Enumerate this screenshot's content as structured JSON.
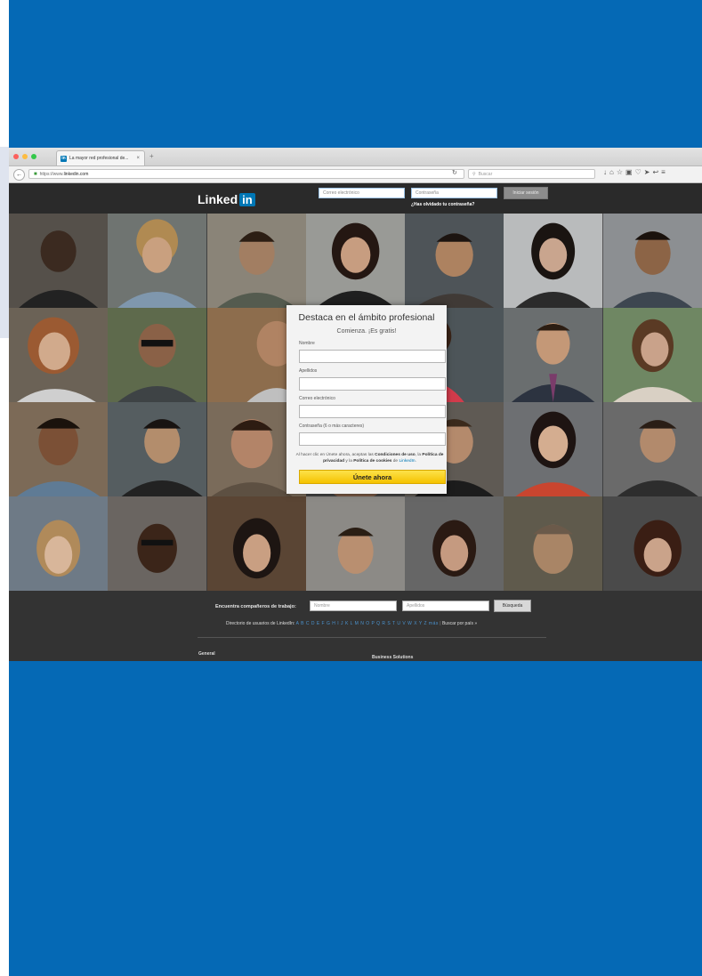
{
  "browser": {
    "tab_title": "La mayor red profesional de...",
    "tab_close": "×",
    "new_tab": "+",
    "url_prefix": "https://www.",
    "url_domain": "linkedin.com",
    "search_placeholder": "Buscar"
  },
  "header": {
    "logo_text": "Linked",
    "logo_badge": "in",
    "email_placeholder": "Correo electrónico",
    "password_placeholder": "Contraseña",
    "login_button": "Iniciar sesión",
    "forgot_link": "¿Has olvidado tu contraseña?"
  },
  "signup": {
    "title": "Destaca en el ámbito profesional",
    "subtitle": "Comienza. ¡Es gratis!",
    "fields": [
      {
        "label": "Nombre"
      },
      {
        "label": "Apellidos"
      },
      {
        "label": "Correo electrónico"
      },
      {
        "label": "Contraseña (6 o más caracteres)"
      }
    ],
    "terms_lead": "Al hacer clic en Únete ahora, aceptas las ",
    "terms_conditions": "Condiciones de uso",
    "terms_mid1": ", la ",
    "terms_privacy": "Política de privacidad",
    "terms_mid2": " y la ",
    "terms_cookies": "Política de cookies",
    "terms_mid3": " de ",
    "terms_brand": "LinkedIn",
    "terms_end": ".",
    "join_button": "Únete ahora"
  },
  "footer": {
    "find_label": "Encuentra compañeros de trabajo:",
    "first_name_placeholder": "Nombre",
    "last_name_placeholder": "Apellidos",
    "search_button": "Búsqueda",
    "directory_label": "Directorio de usuarios de LinkedIn:",
    "directory_letters": "A B C D E F G H I J K L M N O P Q R S T U V W X Y Z más",
    "country_link": "Buscar por país »",
    "general_heading": "General",
    "business_heading": "Business Solutions"
  },
  "colors": {
    "frame_blue": "#0569b5",
    "linkedin_blue": "#0077b5",
    "join_yellow": "#f5c200",
    "header_dark": "#2a2a2a"
  }
}
